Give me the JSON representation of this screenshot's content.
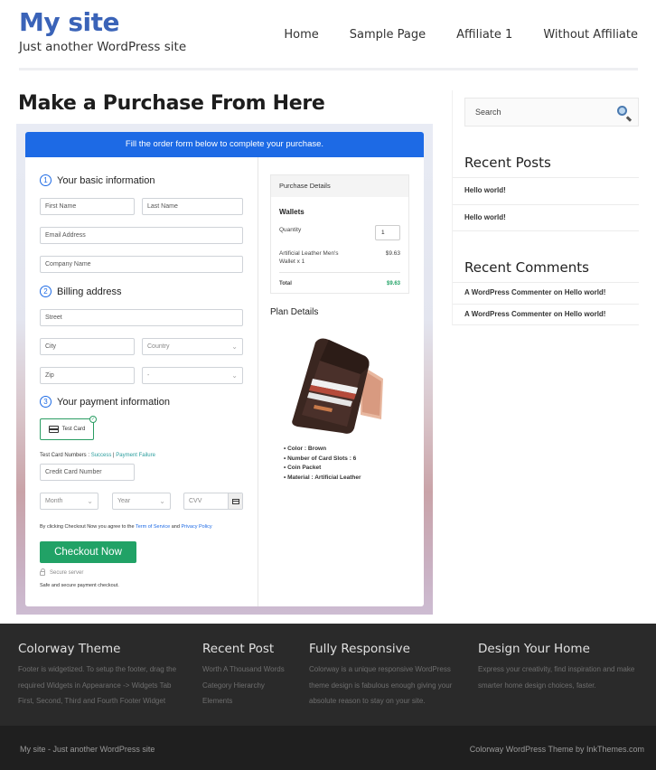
{
  "header": {
    "site_title": "My site",
    "tagline": "Just another WordPress site",
    "nav": [
      "Home",
      "Sample Page",
      "Affiliate 1",
      "Without Affiliate"
    ]
  },
  "page": {
    "title": "Make a Purchase From Here"
  },
  "form": {
    "banner": "Fill the order form below to complete your purchase.",
    "section1": {
      "number": "1",
      "title": "Your basic information"
    },
    "first_name_placeholder": "First Name",
    "last_name_placeholder": "Last Name",
    "email_placeholder": "Email Address",
    "company_placeholder": "Company Name",
    "section2": {
      "number": "2",
      "title": "Billing address"
    },
    "street_placeholder": "Street",
    "city_placeholder": "City",
    "country_selected": "Country",
    "zip_placeholder": "Zip",
    "state_selected": "-",
    "section3": {
      "number": "3",
      "title": "Your payment information"
    },
    "payment_option": "Test Card",
    "test_numbers_label": "Test Card Numbers : ",
    "test_success": "Success",
    "test_sep": " | ",
    "test_failure": "Payment Failure",
    "card_number_placeholder": "Credit Card Number",
    "month_selected": "Month",
    "year_selected": "Year",
    "cvv_placeholder": "CVV",
    "terms_prefix": "By clicking Checkout Now you agree to the ",
    "terms_link": "Term of Service",
    "terms_and": " and ",
    "privacy_link": "Privacy Policy",
    "checkout_label": "Checkout Now",
    "secure_server": "Secure server",
    "safe_text": "Safe and secure payment checkout."
  },
  "purchase": {
    "header": "Purchase Details",
    "product_group": "Wallets",
    "quantity_label": "Quantity",
    "quantity_value": "1",
    "item_name_line1": "Artificial Leather Men's",
    "item_name_line2": "Wallet x 1",
    "item_price": "$9.63",
    "total_label": "Total",
    "total_value": "$9.63",
    "total_color": "#21a266"
  },
  "plan": {
    "title": "Plan Details",
    "features": [
      "Color : Brown",
      "Number of Card Slots : 6",
      "Coin Packet",
      "Material : Artificial Leather"
    ]
  },
  "sidebar": {
    "search_placeholder": "Search",
    "recent_posts_title": "Recent Posts",
    "recent_posts": [
      "Hello world!",
      "Hello world!"
    ],
    "recent_comments_title": "Recent Comments",
    "recent_comments": [
      "A WordPress Commenter on Hello world!",
      "A WordPress Commenter on Hello world!"
    ]
  },
  "footer": {
    "col1": {
      "title": "Colorway Theme",
      "lines": [
        "Footer is widgetized. To setup the footer, drag the",
        "required Widgets in Appearance -> Widgets Tab",
        "First, Second, Third and Fourth Footer Widget"
      ]
    },
    "col2": {
      "title": "Recent Post",
      "items": [
        "Worth A Thousand Words",
        "Category Hierarchy",
        "Elements"
      ]
    },
    "col3": {
      "title": "Fully Responsive",
      "lines": [
        "Colorway is a unique responsive WordPress",
        "theme design is fabulous enough giving your",
        "absolute reason to stay on your site."
      ]
    },
    "col4": {
      "title": "Design Your Home",
      "lines": [
        "Express your creativity, find inspiration and make",
        "smarter home design choices, faster."
      ]
    },
    "bottom_left": "My site - Just another WordPress site",
    "bottom_right": "Colorway WordPress Theme by InkThemes.com"
  },
  "colors": {
    "brand_blue": "#3a63b8",
    "banner_blue": "#1d6ae5",
    "checkout_green": "#21a266"
  }
}
